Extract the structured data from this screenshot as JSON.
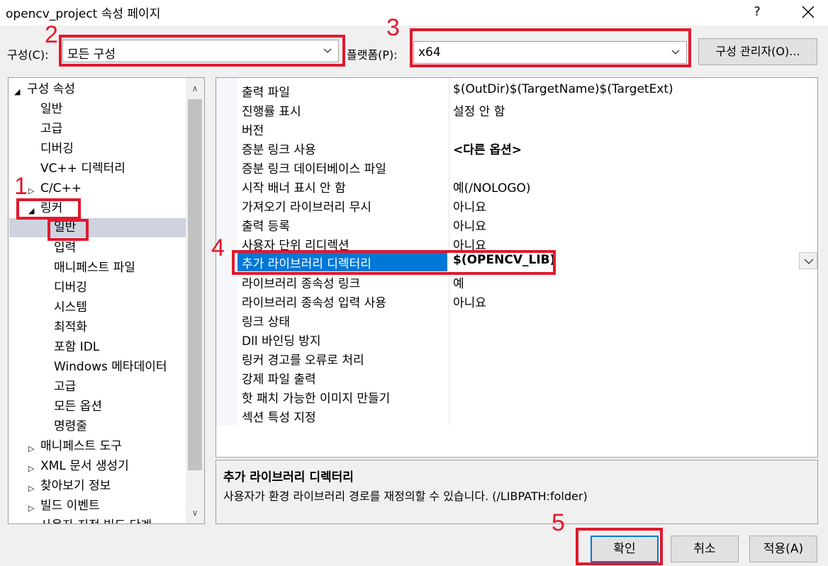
{
  "window": {
    "title": "opencv_project 속성 페이지",
    "help": "?"
  },
  "config_row": {
    "config_label": "구성(C):",
    "config_value": "모든 구성",
    "platform_label": "플랫폼(P):",
    "platform_value": "x64",
    "manager_button": "구성 관리자(O)..."
  },
  "tree": {
    "items": [
      {
        "label": "구성 속성"
      },
      {
        "label": "일반"
      },
      {
        "label": "고급"
      },
      {
        "label": "디버깅"
      },
      {
        "label": "VC++ 디렉터리"
      },
      {
        "label": "C/C++"
      },
      {
        "label": "링커"
      },
      {
        "label": "일반"
      },
      {
        "label": "입력"
      },
      {
        "label": "매니페스트 파일"
      },
      {
        "label": "디버깅"
      },
      {
        "label": "시스템"
      },
      {
        "label": "최적화"
      },
      {
        "label": "포함 IDL"
      },
      {
        "label": "Windows 메타데이터"
      },
      {
        "label": "고급"
      },
      {
        "label": "모든 옵션"
      },
      {
        "label": "명령줄"
      },
      {
        "label": "매니페스트 도구"
      },
      {
        "label": "XML 문서 생성기"
      },
      {
        "label": "찾아보기 정보"
      },
      {
        "label": "빌드 이벤트"
      },
      {
        "label": "사용자 지정 빌드 단계"
      }
    ]
  },
  "grid": {
    "rows": [
      {
        "name": "출력 파일",
        "value": "$(OutDir)$(TargetName)$(TargetExt)"
      },
      {
        "name": "진행률 표시",
        "value": "설정 안 함"
      },
      {
        "name": "버전",
        "value": ""
      },
      {
        "name": "증분 링크 사용",
        "value": "<다른 옵션>"
      },
      {
        "name": "증분 링크 데이터베이스 파일",
        "value": ""
      },
      {
        "name": "시작 배너 표시 안 함",
        "value": "예(/NOLOGO)"
      },
      {
        "name": "가져오기 라이브러리 무시",
        "value": "아니요"
      },
      {
        "name": "출력 등록",
        "value": "아니요"
      },
      {
        "name": "사용자 단위 리디렉션",
        "value": "아니요"
      },
      {
        "name": "추가 라이브러리 디렉터리",
        "value": "$(OPENCV_LIB)"
      },
      {
        "name": "라이브러리 종속성 링크",
        "value": "예"
      },
      {
        "name": "라이브러리 종속성 입력 사용",
        "value": "아니요"
      },
      {
        "name": "링크 상태",
        "value": ""
      },
      {
        "name": "Dll 바인딩 방지",
        "value": ""
      },
      {
        "name": "링커 경고를 오류로 처리",
        "value": ""
      },
      {
        "name": "강제 파일 출력",
        "value": ""
      },
      {
        "name": "핫 패치 가능한 이미지 만들기",
        "value": ""
      },
      {
        "name": "섹션 특성 지정",
        "value": ""
      }
    ]
  },
  "description": {
    "title": "추가 라이브러리 디렉터리",
    "text": "사용자가 환경 라이브러리 경로를 재정의할 수 있습니다. (/LIBPATH:folder)"
  },
  "buttons": {
    "ok": "확인",
    "cancel": "취소",
    "apply": "적용(A)"
  },
  "annotations": {
    "n1": "1",
    "n2": "2",
    "n3": "3",
    "n4": "4",
    "n5": "5",
    "color": "#e0192d"
  },
  "colors": {
    "selection": "#0078d7",
    "tree_selection": "#cfd3e0"
  }
}
